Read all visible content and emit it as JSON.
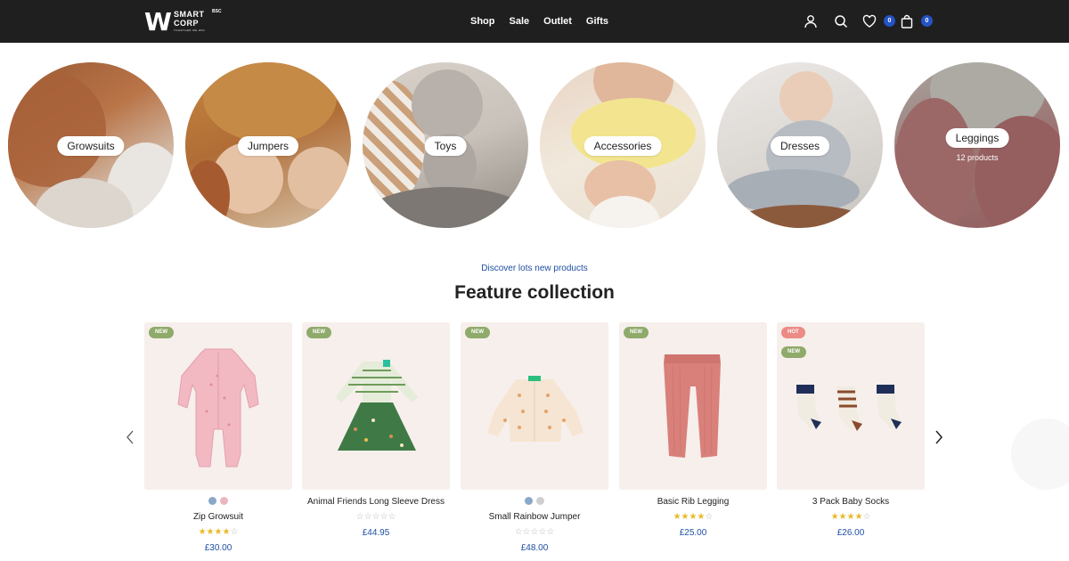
{
  "brand": {
    "logo_mark": "W",
    "logo_line1": "SMART",
    "logo_line2": "CORP",
    "logo_badge": "BSC",
    "logo_tagline": "TOGETHER WE WIN"
  },
  "nav": {
    "items": [
      {
        "label": "Shop"
      },
      {
        "label": "Sale"
      },
      {
        "label": "Outlet"
      },
      {
        "label": "Gifts"
      }
    ]
  },
  "header_icons": {
    "account": "user-icon",
    "search": "search-icon",
    "wishlist": "heart-icon",
    "wishlist_count": "0",
    "cart": "bag-icon",
    "cart_count": "0"
  },
  "categories": [
    {
      "label": "Growsuits",
      "count": ""
    },
    {
      "label": "Jumpers",
      "count": ""
    },
    {
      "label": "Toys",
      "count": ""
    },
    {
      "label": "Accessories",
      "count": ""
    },
    {
      "label": "Dresses",
      "count": ""
    },
    {
      "label": "Leggings",
      "count": "12 products"
    }
  ],
  "section": {
    "eyebrow": "Discover lots new products",
    "title": "Feature collection"
  },
  "products": [
    {
      "name": "Zip Growsuit",
      "price": "£30.00",
      "rating": 4,
      "tags": [
        "NEW"
      ],
      "swatches": [
        "#8aa8c8",
        "#ebb6bf"
      ]
    },
    {
      "name": "Animal Friends Long Sleeve Dress",
      "price": "£44.95",
      "rating": 0,
      "tags": [
        "NEW"
      ],
      "swatches": []
    },
    {
      "name": "Small Rainbow Jumper",
      "price": "£48.00",
      "rating": 0,
      "tags": [
        "NEW"
      ],
      "swatches": [
        "#8aa8c8",
        "#cfcfcf"
      ]
    },
    {
      "name": "Basic Rib Legging",
      "price": "£25.00",
      "rating": 4,
      "tags": [
        "NEW"
      ],
      "swatches": []
    },
    {
      "name": "3 Pack Baby Socks",
      "price": "£26.00",
      "rating": 4,
      "tags": [
        "HOT",
        "NEW"
      ],
      "swatches": []
    }
  ],
  "colors": {
    "header_bg": "#1f1f1f",
    "accent_blue": "#1e4fa3",
    "badge_blue": "#2453c6",
    "tag_new": "#8faa6a",
    "tag_hot": "#ec8a85",
    "star": "#e9b92c"
  }
}
